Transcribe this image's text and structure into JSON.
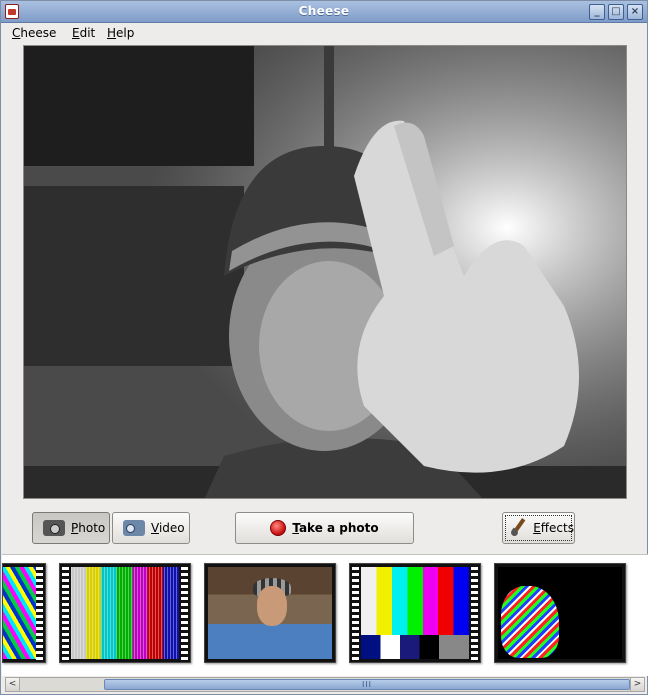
{
  "window": {
    "title": "Cheese"
  },
  "menubar": {
    "items": [
      {
        "mnemonic": "C",
        "rest": "heese"
      },
      {
        "mnemonic": "E",
        "rest": "dit"
      },
      {
        "mnemonic": "H",
        "rest": "elp"
      }
    ]
  },
  "viewport": {
    "content": "webcam-preview"
  },
  "mode_buttons": {
    "photo": {
      "mnemonic": "P",
      "rest": "hoto",
      "pressed": true,
      "icon": "camera-icon"
    },
    "video": {
      "mnemonic": "V",
      "rest": "ideo",
      "pressed": false,
      "icon": "video-camera-icon"
    }
  },
  "take_button": {
    "mnemonic": "T",
    "rest": "ake a photo",
    "icon": "record-icon",
    "icon_color": "#d11a1a"
  },
  "effects_button": {
    "mnemonic": "E",
    "rest": "ffects",
    "icon": "paintbrush-icon"
  },
  "thumbnails": [
    {
      "id": "thumb-effect-warp"
    },
    {
      "id": "thumb-effect-noise"
    },
    {
      "id": "thumb-photo-normal"
    },
    {
      "id": "thumb-effect-colorbars"
    },
    {
      "id": "thumb-effect-edge"
    }
  ],
  "scrollbar": {
    "grip": "III",
    "left_arrow": "<",
    "right_arrow": ">"
  },
  "window_controls": {
    "minimize": "_",
    "maximize": "□",
    "close": "×"
  },
  "colors": {
    "titlebar": "#8faad2",
    "accent": "#d11a1a"
  }
}
